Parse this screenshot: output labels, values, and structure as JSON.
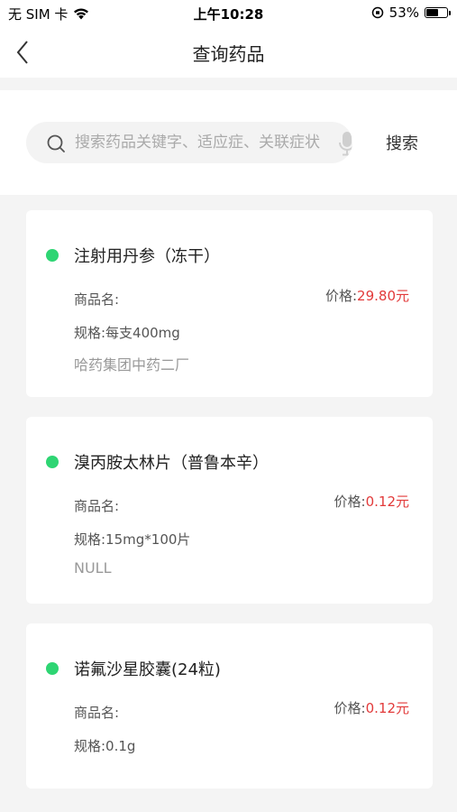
{
  "status_bar": {
    "carrier": "无 SIM 卡",
    "time": "上午10:28",
    "battery_percent": "53%",
    "battery_level": 0.53
  },
  "nav": {
    "title": "查询药品",
    "back_icon": "chevron-left-icon"
  },
  "search": {
    "placeholder": "搜索药品关键字、适应症、关联症状",
    "value": "",
    "button_label": "搜索",
    "search_icon": "magnifier-icon",
    "mic_icon": "microphone-icon"
  },
  "drugs": [
    {
      "name": "注射用丹参（冻干）",
      "trade_name_label": "商品名:",
      "price_label": "价格:",
      "price_value": "29.80元",
      "spec": "规格:每支400mg",
      "manufacturer": "哈药集团中药二厂"
    },
    {
      "name": "溴丙胺太林片（普鲁本辛）",
      "trade_name_label": "商品名:",
      "price_label": "价格:",
      "price_value": "0.12元",
      "spec": "规格:15mg*100片",
      "manufacturer": "NULL"
    },
    {
      "name": "诺氟沙星胶囊(24粒)",
      "trade_name_label": "商品名:",
      "price_label": "价格:",
      "price_value": "0.12元",
      "spec": "规格:0.1g"
    }
  ],
  "colors": {
    "accent_dot": "#2ed573",
    "price": "#e23a3a",
    "background": "#f4f4f4"
  }
}
